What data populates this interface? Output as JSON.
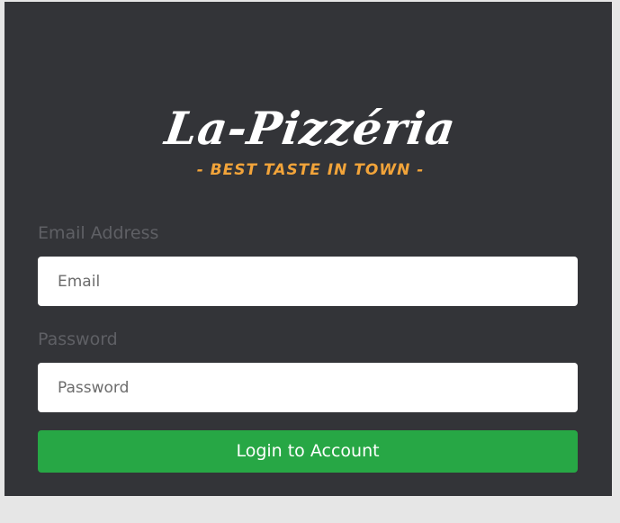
{
  "logo": {
    "title": "La-Pizzéria",
    "tagline": "- BEST TASTE IN TOWN -"
  },
  "form": {
    "email_label": "Email Address",
    "email_placeholder": "Email",
    "email_value": "",
    "password_label": "Password",
    "password_placeholder": "Password",
    "password_value": "",
    "submit_label": "Login to Account"
  },
  "colors": {
    "page_background": "#e6e6e6",
    "card_background": "#333438",
    "label_text": "#5f6065",
    "logo_text": "#ffffff",
    "tagline": "#f2a43a",
    "submit_button": "#27a745"
  }
}
